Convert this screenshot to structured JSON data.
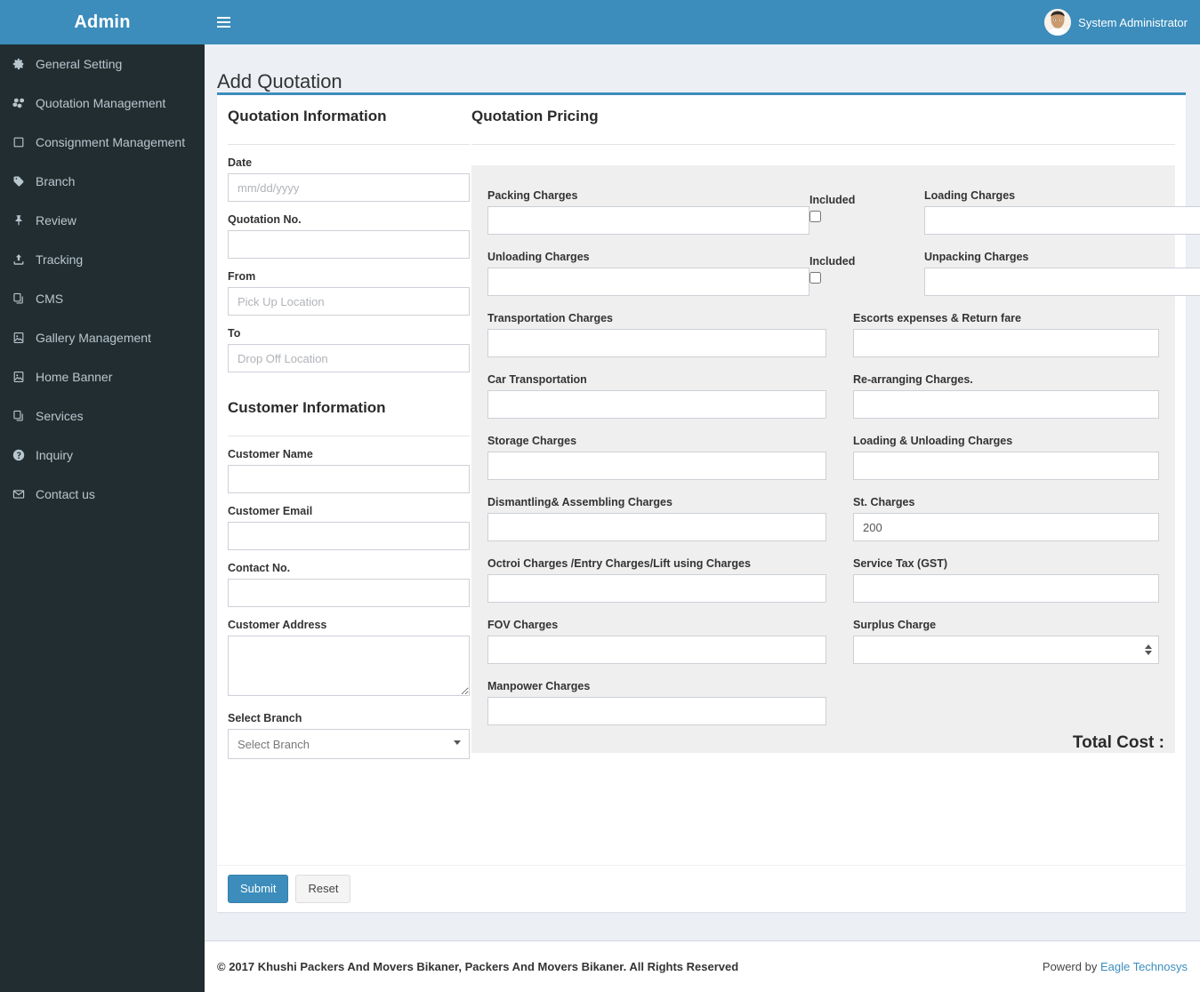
{
  "brand": {
    "title": "Admin"
  },
  "topbar": {
    "menu_toggle": "menu-toggle",
    "user_name": "System Administrator"
  },
  "sidebar": {
    "items": [
      {
        "label": "General Setting",
        "icon": "gear-icon"
      },
      {
        "label": "Quotation Management",
        "icon": "cubes-icon"
      },
      {
        "label": "Consignment Management",
        "icon": "square-icon"
      },
      {
        "label": "Branch",
        "icon": "tag-icon"
      },
      {
        "label": "Review",
        "icon": "thumbtack-icon"
      },
      {
        "label": "Tracking",
        "icon": "upload-icon"
      },
      {
        "label": "CMS",
        "icon": "copy-icon"
      },
      {
        "label": "Gallery Management",
        "icon": "image-file-icon"
      },
      {
        "label": "Home Banner",
        "icon": "image-file-icon"
      },
      {
        "label": "Services",
        "icon": "copy-icon"
      },
      {
        "label": "Inquiry",
        "icon": "question-circle-icon"
      },
      {
        "label": "Contact us",
        "icon": "envelope-icon"
      }
    ]
  },
  "page": {
    "title": "Add Quotation"
  },
  "quotation_information": {
    "heading": "Quotation Information",
    "fields": {
      "date": {
        "label": "Date",
        "placeholder": "mm/dd/yyyy",
        "value": ""
      },
      "quotation_no": {
        "label": "Quotation No.",
        "placeholder": "",
        "value": ""
      },
      "from": {
        "label": "From",
        "placeholder": "Pick Up Location",
        "value": ""
      },
      "to": {
        "label": "To",
        "placeholder": "Drop Off Location",
        "value": ""
      }
    }
  },
  "customer_information": {
    "heading": "Customer Information",
    "fields": {
      "customer_name": {
        "label": "Customer Name",
        "placeholder": "",
        "value": ""
      },
      "customer_email": {
        "label": "Customer Email",
        "placeholder": "",
        "value": ""
      },
      "contact_no": {
        "label": "Contact No.",
        "placeholder": "",
        "value": ""
      },
      "customer_address": {
        "label": "Customer Address",
        "placeholder": "",
        "value": ""
      },
      "select_branch": {
        "label": "Select Branch",
        "selected": "Select Branch",
        "options": [
          "Select Branch"
        ]
      }
    }
  },
  "quotation_pricing": {
    "heading": "Quotation Pricing",
    "included_label": "Included",
    "checkbox_rows": [
      {
        "left": {
          "label": "Packing Charges",
          "value": "",
          "included": false
        },
        "right": {
          "label": "Loading Charges",
          "value": "",
          "included": false
        }
      },
      {
        "left": {
          "label": "Unloading Charges",
          "value": "",
          "included": false
        },
        "right": {
          "label": "Unpacking Charges",
          "value": "",
          "included": false
        }
      }
    ],
    "rows": [
      {
        "left": {
          "label": "Transportation Charges",
          "value": "",
          "type": "text"
        },
        "right": {
          "label": "Escorts expenses & Return fare",
          "value": "",
          "type": "text"
        }
      },
      {
        "left": {
          "label": "Car Transportation",
          "value": "",
          "type": "text"
        },
        "right": {
          "label": "Re-arranging Charges.",
          "value": "",
          "type": "text"
        }
      },
      {
        "left": {
          "label": "Storage Charges",
          "value": "",
          "type": "text"
        },
        "right": {
          "label": "Loading & Unloading Charges",
          "value": "",
          "type": "text"
        }
      },
      {
        "left": {
          "label": "Dismantling& Assembling Charges",
          "value": "",
          "type": "text"
        },
        "right": {
          "label": "St. Charges",
          "value": "200",
          "type": "text"
        }
      },
      {
        "left": {
          "label": "Octroi Charges /Entry Charges/Lift using Charges",
          "value": "",
          "type": "text"
        },
        "right": {
          "label": "Service Tax (GST)",
          "value": "",
          "type": "text"
        }
      },
      {
        "left": {
          "label": "FOV Charges",
          "value": "",
          "type": "text"
        },
        "right": {
          "label": "Surplus Charge",
          "value": "",
          "type": "number"
        }
      },
      {
        "left": {
          "label": "Manpower Charges",
          "value": "",
          "type": "text"
        },
        "right": null
      }
    ],
    "total_cost_label": "Total Cost :",
    "total_cost_value": ""
  },
  "form_actions": {
    "submit_label": "Submit",
    "reset_label": "Reset"
  },
  "footer": {
    "copyright": "© 2017 Khushi Packers And Movers Bikaner, Packers And Movers Bikaner. All Rights Reserved",
    "powered_prefix": "Powerd by ",
    "powered_link": "Eagle Technosys"
  },
  "colors": {
    "header_blue": "#3c8dbc",
    "sidebar_dark": "#222d32",
    "page_bg": "#ecf0f5",
    "panel_gray": "#efefef",
    "link_blue": "#3c8dbc"
  }
}
